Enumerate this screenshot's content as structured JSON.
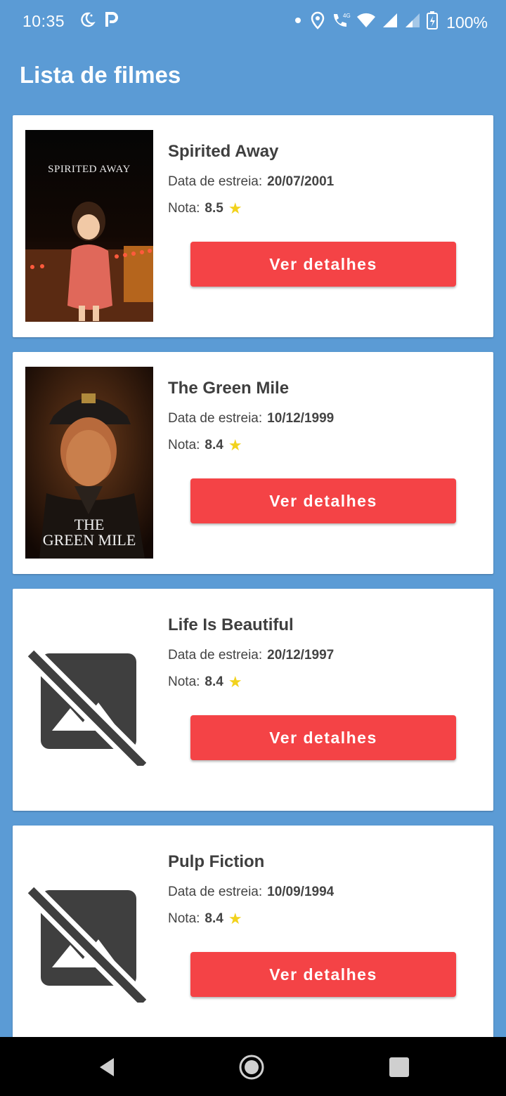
{
  "status_bar": {
    "time": "10:35",
    "battery": "100%",
    "icons": [
      "night-mode-icon",
      "parking-app-icon",
      "dot-icon",
      "location-icon",
      "wifi-calling-icon",
      "wifi-icon",
      "signal-icon",
      "signal-weak-icon",
      "battery-charging-icon"
    ]
  },
  "header": {
    "title": "Lista de filmes"
  },
  "labels": {
    "release": "Data de estreia:",
    "rating": "Nota:",
    "details_button": "Ver detalhes"
  },
  "movies": [
    {
      "title": "Spirited Away",
      "release_date": "20/07/2001",
      "rating": "8.5",
      "poster": "spirited-away-poster",
      "poster_text": "SPIRITED AWAY"
    },
    {
      "title": "The Green Mile",
      "release_date": "10/12/1999",
      "rating": "8.4",
      "poster": "green-mile-poster",
      "poster_text_1": "THE",
      "poster_text_2": "GREEN MILE"
    },
    {
      "title": "Life Is Beautiful",
      "release_date": "20/12/1997",
      "rating": "8.4",
      "poster": "image-not-available-icon"
    },
    {
      "title": "Pulp Fiction",
      "release_date": "10/09/1994",
      "rating": "8.4",
      "poster": "image-not-available-icon"
    }
  ],
  "colors": {
    "background": "#5b9bd5",
    "button": "#f44346",
    "star": "#f2d21d",
    "title_text": "#3f3f3f"
  },
  "nav": {
    "icons": [
      "back-icon",
      "home-icon",
      "recents-icon"
    ]
  }
}
